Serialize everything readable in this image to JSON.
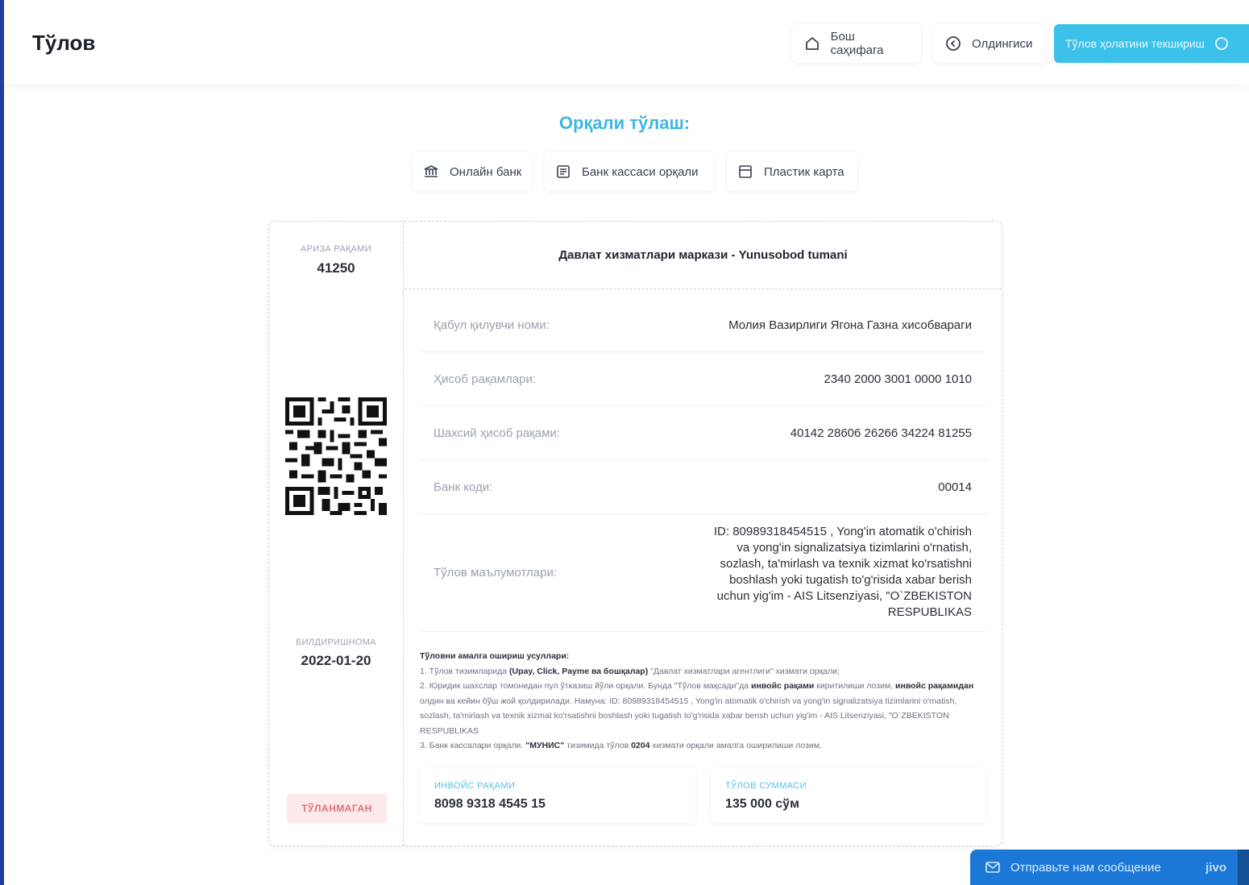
{
  "header": {
    "title": "Тўлов",
    "home_label": "Бош саҳифага",
    "prev_label": "Олдингиси",
    "check_label": "Тўлов ҳолатини текшириш"
  },
  "pay_via": {
    "title": "Орқали тўлаш:",
    "methods": [
      "Онлайн банк",
      "Банк кассаси орқали",
      "Пластик карта"
    ]
  },
  "stub": {
    "app_number_label": "АРИЗА РАҚАМИ",
    "app_number": "41250",
    "notice_label": "БИЛДИРИШНОМА",
    "notice_date": "2022-01-20",
    "status": "ТЎЛАНМАГАН"
  },
  "organization": "Давлат хизматлари маркази - Yunusobod tumani",
  "details": [
    {
      "label": "Қабул қилувчи номи:",
      "value": "Молия Вазирлиги Ягона Газна хисобвараги"
    },
    {
      "label": "Ҳисоб рақамлари:",
      "value": "2340 2000 3001 0000 1010"
    },
    {
      "label": "Шахсий ҳисоб рақами:",
      "value": "40142 28606 26266 34224 81255"
    },
    {
      "label": "Банк коди:",
      "value": "00014"
    },
    {
      "label": "Тўлов маълумотлари:",
      "value": "ID: 80989318454515 , Yong'in atomatik o'chirish va yong'in signalizatsiya tizimlarini o'rnatish, sozlash, ta'mirlash va texnik xizmat ko'rsatishni boshlash yoki tugatish to'g'risida xabar berish uchun yig'im - AIS Litsenziyasi, \"O`ZBEKISTON RESPUBLIKAS"
    }
  ],
  "methods_info": {
    "title": "Тўловни амалга ошириш усуллари:",
    "line1_a": "1. Тўлов тизимларида ",
    "line1_b": "(Upay, Click, Payme ва бошқалар)",
    "line1_c": " \"Давлат хизматлари агентлиги\" хизмати орқали;",
    "line2_a": "2. Юридик шахслар томонидан пул ўтказиш йўли орқали. Бунда \"Тўлов мақсади\"да ",
    "line2_b": "инвойс рақами",
    "line2_c": " киритилиши лозим,",
    "line2_d": "инвойс рақамидан",
    "line2_e": " олдин ва кейин бўш жой қолдирилади. Намуна: ID: 80989318454515 , Yong'in atomatik o'chirish va yong'in signalizatsiya tizimlarini o'rnatish, sozlash, ta'mirlash va texnik xizmat ko'rsatishni boshlash yoki tugatish to'g'risida xabar berish uchun yig'im - AIS Litsenziyasi, \"O`ZBEKISTON RESPUBLIKAS",
    "line3_a": "3. Банк кассалари орқали. ",
    "line3_b": "\"МУНИС\"",
    "line3_c": " тизимида тўлов ",
    "line3_d": "0204",
    "line3_e": " хизмати орқали амалга оширилиши лозим."
  },
  "invoice": {
    "label": "ИНВОЙС РАҚАМИ",
    "value": "8098 9318 4545 15"
  },
  "sum": {
    "label": "ТЎЛОВ СУММАСИ",
    "value": "135 000 сўм"
  },
  "chat": {
    "label": "Отправьте нам сообщение",
    "brand": "jivo"
  },
  "colors": {
    "accent": "#3cc1ea",
    "rail": "#1f3f9e",
    "chat": "#1b78d6",
    "status_bg": "#fde8ea",
    "status_text": "#e0707c"
  }
}
